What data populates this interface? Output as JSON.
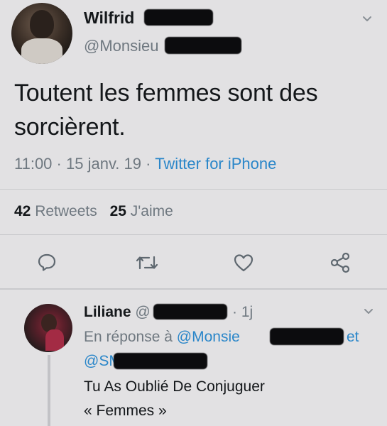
{
  "tweet": {
    "author_name": "Wilfrid",
    "author_handle": "@Monsieu",
    "text_line1": "Toutent les femmes sont des",
    "text_line2": "sorcièrent.",
    "time": "11:00",
    "sep1": "·",
    "date": "15 janv. 19",
    "sep2": "·",
    "source": "Twitter for iPhone",
    "retweets_count": "42",
    "retweets_label": "Retweets",
    "likes_count": "25",
    "likes_label": "J'aime"
  },
  "reply": {
    "author_name": "Liliane",
    "handle_prefix": "@",
    "age": "· 1j",
    "in_reply_prefix": "En réponse à",
    "in_reply_handle1": "@Monsie",
    "in_reply_conj": "et",
    "in_reply_handle2": "@SM",
    "text_line1": "Tu As Oublié De Conjuguer",
    "text_line2": "« Femmes »"
  },
  "icons": {
    "reply": "reply-icon",
    "retweet": "retweet-icon",
    "like": "heart-icon",
    "share": "share-icon",
    "menu": "chevron-down-icon"
  },
  "colors": {
    "link": "#2a86c9",
    "muted": "#6f7880",
    "text": "#14171a",
    "background": "#e2e1e3"
  }
}
